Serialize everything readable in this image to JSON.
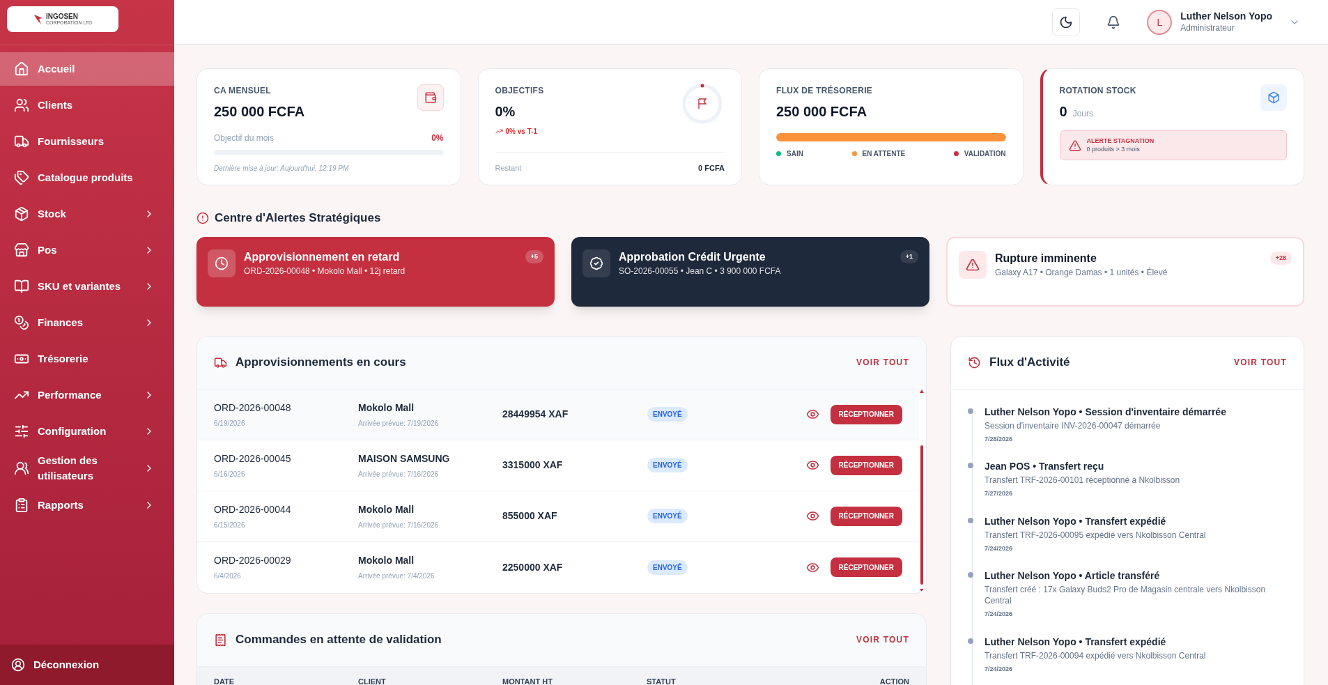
{
  "logo": {
    "name": "INGOSEN",
    "tagline": "CORPORATION LTD"
  },
  "sidebar": {
    "items": [
      {
        "label": "Accueil",
        "selected": true,
        "has_submenu": false
      },
      {
        "label": "Clients",
        "selected": false,
        "has_submenu": false
      },
      {
        "label": "Fournisseurs",
        "selected": false,
        "has_submenu": false
      },
      {
        "label": "Catalogue produits",
        "selected": false,
        "has_submenu": false
      },
      {
        "label": "Stock",
        "selected": false,
        "has_submenu": true
      },
      {
        "label": "Pos",
        "selected": false,
        "has_submenu": true
      },
      {
        "label": "SKU et variantes",
        "selected": false,
        "has_submenu": true
      },
      {
        "label": "Finances",
        "selected": false,
        "has_submenu": true
      },
      {
        "label": "Trésorerie",
        "selected": false,
        "has_submenu": false
      },
      {
        "label": "Performance",
        "selected": false,
        "has_submenu": true
      },
      {
        "label": "Configuration",
        "selected": false,
        "has_submenu": true
      },
      {
        "label": "Gestion des utilisateurs",
        "selected": false,
        "has_submenu": true
      },
      {
        "label": "Rapports",
        "selected": false,
        "has_submenu": true
      }
    ],
    "logout": "Déconnexion"
  },
  "topbar": {
    "user": {
      "initial": "L",
      "name": "Luther Nelson Yopo",
      "role": "Administrateur"
    }
  },
  "kpis": [
    {
      "kind": "progress",
      "title": "CA MENSUEL",
      "value": "250 000 FCFA",
      "progress_label": "Objectif du mois",
      "progress_value": "0%",
      "note": "Dernière mise à jour: Aujourd'hui, 12:19 PM"
    },
    {
      "kind": "goal",
      "title": "OBJECTIFS",
      "value": "0%",
      "trend": "0% vs T-1",
      "footer_label": "Restant",
      "footer_value": "0 FCFA"
    },
    {
      "kind": "cashflow",
      "title": "FLUX DE TRÉSORERIE",
      "value": "250 000 FCFA",
      "level": 1,
      "legend": [
        {
          "label": "SAIN",
          "color": "#10b981"
        },
        {
          "label": "EN ATTENTE",
          "color": "#fb923c"
        },
        {
          "label": "VALIDATION",
          "color": "#c4303f"
        }
      ]
    },
    {
      "kind": "rotation",
      "title": "ROTATION STOCK",
      "value": "0",
      "unit": "Jours",
      "alert_title": "ALERTE STAGNATION",
      "alert_text": "0 produits > 3 mois"
    }
  ],
  "alerts": {
    "title": "Centre d'Alertes Stratégiques",
    "items": [
      {
        "kind": "danger",
        "title": "Approvisionnement en retard",
        "detail": "ORD-2026-00048 • Mokolo Mall • 12j retard",
        "count": "+5"
      },
      {
        "kind": "dark",
        "title": "Approbation Crédit Urgente",
        "detail": "SO-2026-00055 • Jean C • 3 900 000 FCFA",
        "count": "+1"
      },
      {
        "kind": "light",
        "title": "Rupture imminente",
        "detail": "Galaxy A17 • Orange Damas • 1 unités • Élevé",
        "count": "+28"
      }
    ]
  },
  "supplies": {
    "title": "Approvisionnements en cours",
    "link": "VOIR TOUT",
    "rows": [
      {
        "id": "ORD-2026-00048",
        "date": "6/19/2026",
        "supplier": "Mokolo Mall",
        "eta": "Arrivée prévue: 7/19/2026",
        "amount": "28449954 XAF",
        "status": "ENVOYÉ",
        "action": "RÉCEPTIONNER"
      },
      {
        "id": "ORD-2026-00045",
        "date": "6/16/2026",
        "supplier": "MAISON SAMSUNG",
        "eta": "Arrivée prévue: 7/16/2026",
        "amount": "3315000 XAF",
        "status": "ENVOYÉ",
        "action": "RÉCEPTIONNER"
      },
      {
        "id": "ORD-2026-00044",
        "date": "6/15/2026",
        "supplier": "Mokolo Mall",
        "eta": "Arrivée prévue: 7/16/2026",
        "amount": "855000 XAF",
        "status": "ENVOYÉ",
        "action": "RÉCEPTIONNER"
      },
      {
        "id": "ORD-2026-00029",
        "date": "6/4/2026",
        "supplier": "Mokolo Mall",
        "eta": "Arrivée prévue: 7/4/2026",
        "amount": "2250000 XAF",
        "status": "ENVOYÉ",
        "action": "RÉCEPTIONNER"
      }
    ]
  },
  "pending": {
    "title": "Commandes en attente de validation",
    "link": "VOIR TOUT",
    "columns": [
      "DATE",
      "CLIENT",
      "MONTANT HT",
      "STATUT",
      "ACTION"
    ]
  },
  "activity": {
    "title": "Flux d'Activité",
    "link": "VOIR TOUT",
    "items": [
      {
        "title": "Luther Nelson Yopo • Session d'inventaire démarrée",
        "detail": "Session d'inventaire INV-2026-00047 démarrée",
        "date": "7/28/2026"
      },
      {
        "title": "Jean POS • Transfert reçu",
        "detail": "Transfert TRF-2026-00101 réceptionné à Nkolbisson",
        "date": "7/27/2026"
      },
      {
        "title": "Luther Nelson Yopo • Transfert expédié",
        "detail": "Transfert TRF-2026-00095 expédié vers Nkolbisson Central",
        "date": "7/24/2026"
      },
      {
        "title": "Luther Nelson Yopo • Article transféré",
        "detail": "Transfert créé : 17x Galaxy Buds2 Pro de Magasin centrale vers Nkolbisson Central",
        "date": "7/24/2026"
      },
      {
        "title": "Luther Nelson Yopo • Transfert expédié",
        "detail": "Transfert TRF-2026-00094 expédié vers Nkolbisson Central",
        "date": "7/24/2026"
      }
    ]
  }
}
